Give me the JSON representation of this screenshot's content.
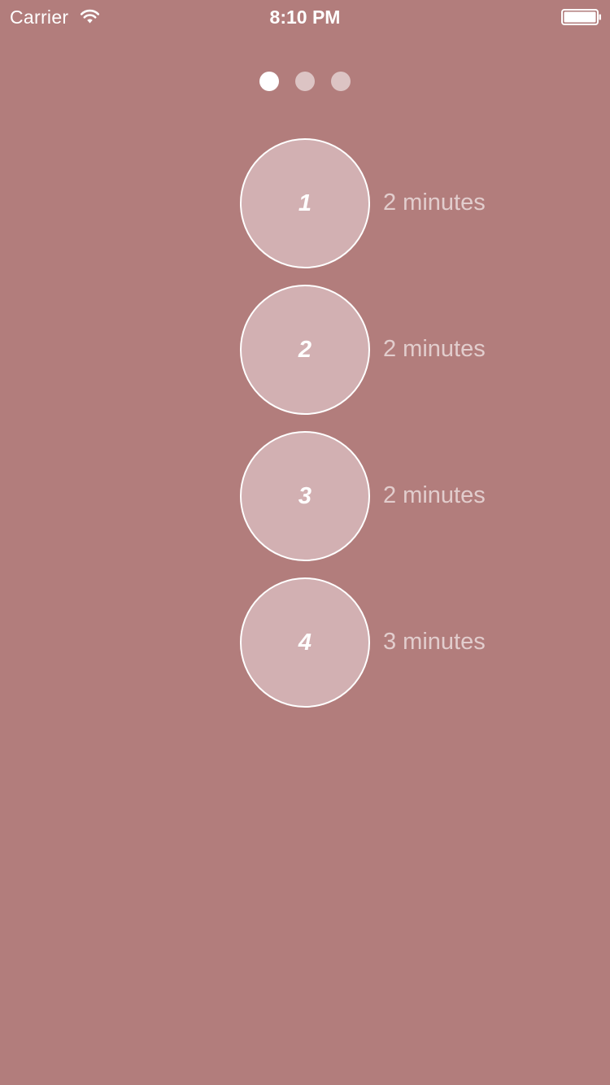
{
  "status_bar": {
    "carrier": "Carrier",
    "time": "8:10 PM",
    "wifi_icon": "wifi-icon",
    "battery_icon": "battery-icon"
  },
  "page_indicator": {
    "total": 3,
    "active_index": 0
  },
  "steps": [
    {
      "number": "1",
      "duration": "2 minutes"
    },
    {
      "number": "2",
      "duration": "2 minutes"
    },
    {
      "number": "3",
      "duration": "2 minutes"
    },
    {
      "number": "4",
      "duration": "3 minutes"
    }
  ],
  "colors": {
    "background": "#b27d7c",
    "circle_fill": "#d2b0b2",
    "circle_border": "#ffffff",
    "text": "#ffffff"
  }
}
